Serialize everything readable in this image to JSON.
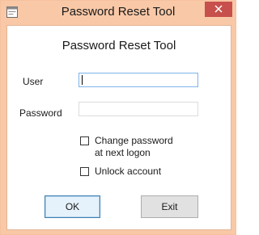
{
  "window": {
    "title": "Password Reset Tool",
    "app_icon": "form-icon",
    "close_icon": "close-icon",
    "frame_color": "#f9c8a7",
    "close_color": "#c7504c"
  },
  "form": {
    "heading": "Password Reset Tool",
    "user_label": "User",
    "user_value": "",
    "password_label": "Password",
    "password_value": "",
    "change_password_line1": "Change password",
    "change_password_line2": "at next logon",
    "change_password_checked": false,
    "unlock_account_label": "Unlock account",
    "unlock_account_checked": false
  },
  "buttons": {
    "ok_label": "OK",
    "exit_label": "Exit"
  }
}
